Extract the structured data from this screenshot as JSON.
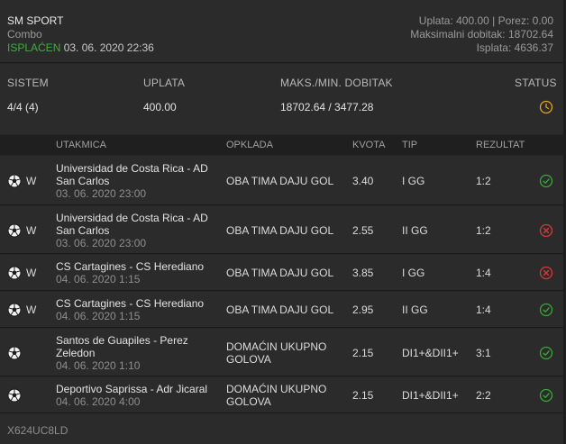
{
  "header": {
    "title": "SM SPORT",
    "type": "Combo",
    "status": "ISPLAĆEN",
    "datetime": "03. 06. 2020 22:36",
    "stake_line": "Uplata: 400.00 | Porez: 0.00",
    "max_win_line": "Maksimalni dobitak: 18702.64",
    "payout_line": "Isplata: 4636.37"
  },
  "summary": {
    "system_label": "SISTEM",
    "system_value": "4/4 (4)",
    "stake_label": "UPLATA",
    "stake_value": "400.00",
    "win_label": "MAKS./MIN. DOBITAK",
    "win_value": "18702.64 / 3477.28",
    "status_label": "STATUS",
    "status_icon": "clock-icon"
  },
  "columns": {
    "match": "UTAKMICA",
    "bet": "OPKLADA",
    "odds": "KVOTA",
    "tip": "TIP",
    "result": "REZULTAT"
  },
  "rows": [
    {
      "flag": "W",
      "match_l1": "Universidad de Costa Rica - AD",
      "match_l2": "San Carlos",
      "date": "03. 06. 2020 23:00",
      "bet_l1": "OBA TIMA DAJU GOL",
      "bet_l2": "",
      "odds": "3.40",
      "tip": "I GG",
      "result": "1:2",
      "status": "won"
    },
    {
      "flag": "W",
      "match_l1": "Universidad de Costa Rica - AD",
      "match_l2": "San Carlos",
      "date": "03. 06. 2020 23:00",
      "bet_l1": "OBA TIMA DAJU GOL",
      "bet_l2": "",
      "odds": "2.55",
      "tip": "II GG",
      "result": "1:2",
      "status": "lost"
    },
    {
      "flag": "W",
      "match_l1": "CS Cartagines - CS Herediano",
      "match_l2": "",
      "date": "04. 06. 2020 1:15",
      "bet_l1": "OBA TIMA DAJU GOL",
      "bet_l2": "",
      "odds": "3.85",
      "tip": "I GG",
      "result": "1:4",
      "status": "lost"
    },
    {
      "flag": "W",
      "match_l1": "CS Cartagines - CS Herediano",
      "match_l2": "",
      "date": "04. 06. 2020 1:15",
      "bet_l1": "OBA TIMA DAJU GOL",
      "bet_l2": "",
      "odds": "2.95",
      "tip": "II GG",
      "result": "1:4",
      "status": "won"
    },
    {
      "flag": "",
      "match_l1": "Santos de Guapiles - Perez",
      "match_l2": "Zeledon",
      "date": "04. 06. 2020 1:10",
      "bet_l1": "DOMAĆIN UKUPNO",
      "bet_l2": "GOLOVA",
      "odds": "2.15",
      "tip": "DI1+&DII1+",
      "result": "3:1",
      "status": "won"
    },
    {
      "flag": "",
      "match_l1": "Deportivo Saprissa - Adr Jicaral",
      "match_l2": "",
      "date": "04. 06. 2020 4:00",
      "bet_l1": "DOMAĆIN UKUPNO",
      "bet_l2": "GOLOVA",
      "odds": "2.15",
      "tip": "DI1+&DII1+",
      "result": "2:2",
      "status": "won"
    }
  ],
  "footer": {
    "ticket_code": "X624UC8LD"
  },
  "colors": {
    "won": "#3aa63a",
    "lost": "#d23a3a",
    "pending": "#e0a526",
    "paid": "#3fae3f"
  }
}
